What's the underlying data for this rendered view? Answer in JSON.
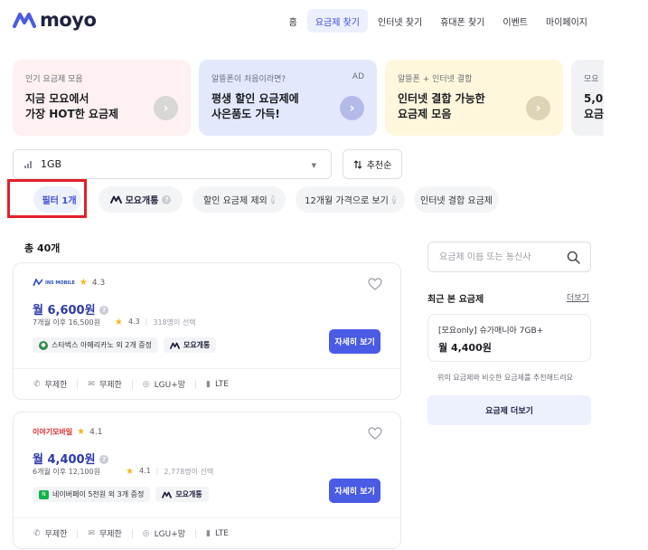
{
  "header": {
    "logo_text": "moyo",
    "nav": [
      {
        "label": "홈",
        "active": false
      },
      {
        "label": "요금제 찾기",
        "active": true
      },
      {
        "label": "인터넷 찾기",
        "active": false
      },
      {
        "label": "휴대폰 찾기",
        "active": false
      },
      {
        "label": "이벤트",
        "active": false
      },
      {
        "label": "마이페이지",
        "active": false
      }
    ]
  },
  "banners": [
    {
      "small": "인기 요금제 모음",
      "line1": "지금 모요에서",
      "line2": "가장 HOT한 요금제",
      "ad": ""
    },
    {
      "small": "알뜰폰이 처음이라면?",
      "line1": "평생 할인 요금제에",
      "line2": "사은품도 가득!",
      "ad": "AD"
    },
    {
      "small": "알뜰폰 + 인터넷 결합",
      "line1": "인터넷 결합 가능한",
      "line2": "요금제 모음",
      "ad": ""
    },
    {
      "small": "모요",
      "line1": "5,0",
      "line2": "요금",
      "ad": ""
    }
  ],
  "filters": {
    "data_select": "1GB",
    "sort_label": "추천순",
    "chips": {
      "filter": "필터 1개",
      "moyo_open": "모요개통",
      "exclude_discount": "할인 요금제 제외",
      "twelve_month": "12개월 가격으로 보기",
      "internet_bundle": "인터넷 결합 요금제"
    }
  },
  "results": {
    "total": "총 40개",
    "cards": [
      {
        "brand": "INS MOBILE",
        "rating": "4.3",
        "price": "월 6,600원",
        "after": "7개월 이후 16,500원",
        "sub_rating": "4.3",
        "selected": "318명이 선택",
        "benefit": "스타벅스 아메리카노 외 2개 증정",
        "moyo_badge": "모요개통",
        "detail_label": "자세히 보기",
        "spec": [
          "무제한",
          "무제한",
          "LGU+망",
          "LTE"
        ]
      },
      {
        "brand": "이야기모바일",
        "rating": "4.1",
        "price": "월 4,400원",
        "after": "6개월 이후 12,100원",
        "sub_rating": "4.1",
        "selected": "2,778명이 선택",
        "benefit": "네이버페이 5천원 외 3개 증정",
        "moyo_badge": "모요개통",
        "detail_label": "자세히 보기",
        "spec": [
          "무제한",
          "무제한",
          "LGU+망",
          "LTE"
        ]
      }
    ]
  },
  "sidebar": {
    "search_placeholder": "요금제 이름 또는 통신사",
    "recent_title": "최근 본 요금제",
    "more_label": "더보기",
    "recent_item": {
      "name": "[모요only] 슈가매니아 7GB+",
      "price": "월 4,400원"
    },
    "recommend_text": "위의 요금제와 비슷한 요금제를 추천해드려요",
    "more_plans_label": "요금제 더보기"
  },
  "colors": {
    "accent": "#4a5be6",
    "highlight_box": "#e3202a",
    "price": "#2d3aa8"
  }
}
